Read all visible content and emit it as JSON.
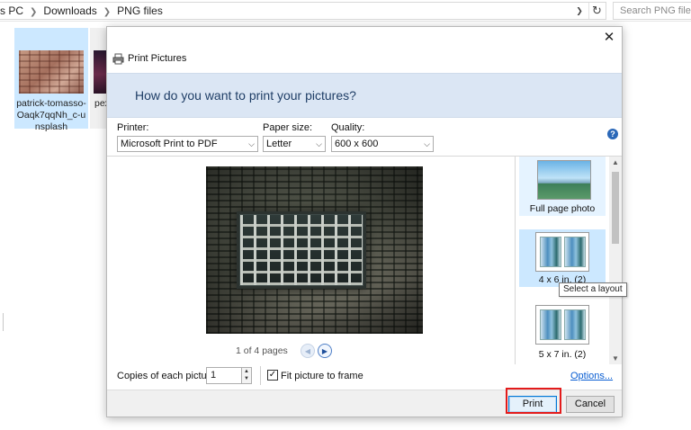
{
  "explorer": {
    "breadcrumb": [
      "s PC",
      "Downloads",
      "PNG files"
    ],
    "search_placeholder": "Search PNG files",
    "files": [
      {
        "name": "patrick-tomasso-Oaqk7qqNh_c-unsplash",
        "selected": true
      },
      {
        "name": "pex",
        "selected": false
      }
    ]
  },
  "dialog": {
    "title": "Print Pictures",
    "banner": "How do you want to print your pictures?",
    "printer": {
      "label": "Printer:",
      "value": "Microsoft Print to PDF"
    },
    "paper_size": {
      "label": "Paper size:",
      "value": "Letter"
    },
    "quality": {
      "label": "Quality:",
      "value": "600 x 600"
    },
    "page_info": "1 of 4 pages",
    "layouts": [
      {
        "label": "Full page photo",
        "selected": false
      },
      {
        "label": "4 x 6 in. (2)",
        "selected": true
      },
      {
        "label": "5 x 7 in. (2)",
        "selected": false
      }
    ],
    "tooltip": "Select a layout",
    "copies": {
      "label": "Copies of each picture:",
      "value": "1"
    },
    "fit": {
      "label": "Fit picture to frame",
      "checked": true
    },
    "options_link": "Options...",
    "buttons": {
      "print": "Print",
      "cancel": "Cancel"
    }
  },
  "icons": {
    "close": "close-icon",
    "help": "help-icon",
    "printer": "printer-icon",
    "refresh": "refresh-icon"
  },
  "colors": {
    "banner_bg": "#dbe6f4",
    "banner_text": "#1f3e66",
    "selection": "#cce8ff",
    "link": "#0a5ed2",
    "highlight": "#e31b1b"
  }
}
